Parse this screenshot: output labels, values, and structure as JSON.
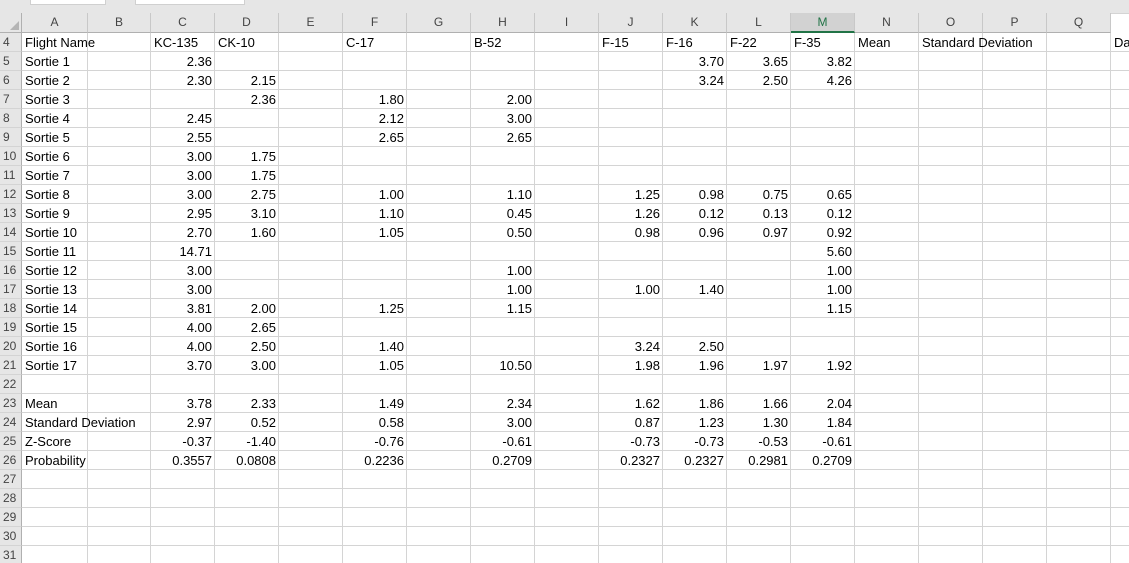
{
  "columns": [
    "A",
    "B",
    "C",
    "D",
    "E",
    "F",
    "G",
    "H",
    "I",
    "J",
    "K",
    "L",
    "M",
    "N",
    "O",
    "P",
    "Q"
  ],
  "selected_column": "M",
  "rows": [
    {
      "num": "4",
      "cells": [
        {
          "col": "A",
          "text": "Flight Name",
          "align": "l"
        },
        {
          "col": "C",
          "text": "KC-135",
          "align": "l"
        },
        {
          "col": "D",
          "text": "CK-10",
          "align": "l"
        },
        {
          "col": "F",
          "text": "C-17",
          "align": "l"
        },
        {
          "col": "H",
          "text": "B-52",
          "align": "l"
        },
        {
          "col": "J",
          "text": "F-15",
          "align": "l"
        },
        {
          "col": "K",
          "text": "F-16",
          "align": "l"
        },
        {
          "col": "L",
          "text": "F-22",
          "align": "l"
        },
        {
          "col": "M",
          "text": "F-35",
          "align": "l"
        },
        {
          "col": "N",
          "text": "Mean",
          "align": "l"
        },
        {
          "col": "O",
          "text": "Standard Deviation",
          "align": "l"
        },
        {
          "col": "R",
          "text": "Da",
          "align": "l"
        }
      ]
    },
    {
      "num": "5",
      "cells": [
        {
          "col": "A",
          "text": "Sortie 1",
          "align": "l"
        },
        {
          "col": "C",
          "text": "2.36",
          "align": "r"
        },
        {
          "col": "K",
          "text": "3.70",
          "align": "r"
        },
        {
          "col": "L",
          "text": "3.65",
          "align": "r"
        },
        {
          "col": "M",
          "text": "3.82",
          "align": "r"
        }
      ]
    },
    {
      "num": "6",
      "cells": [
        {
          "col": "A",
          "text": "Sortie 2",
          "align": "l"
        },
        {
          "col": "C",
          "text": "2.30",
          "align": "r"
        },
        {
          "col": "D",
          "text": "2.15",
          "align": "r"
        },
        {
          "col": "K",
          "text": "3.24",
          "align": "r"
        },
        {
          "col": "L",
          "text": "2.50",
          "align": "r"
        },
        {
          "col": "M",
          "text": "4.26",
          "align": "r"
        }
      ]
    },
    {
      "num": "7",
      "cells": [
        {
          "col": "A",
          "text": "Sortie 3",
          "align": "l"
        },
        {
          "col": "D",
          "text": "2.36",
          "align": "r"
        },
        {
          "col": "F",
          "text": "1.80",
          "align": "r"
        },
        {
          "col": "H",
          "text": "2.00",
          "align": "r"
        }
      ]
    },
    {
      "num": "8",
      "cells": [
        {
          "col": "A",
          "text": "Sortie 4",
          "align": "l"
        },
        {
          "col": "C",
          "text": "2.45",
          "align": "r"
        },
        {
          "col": "F",
          "text": "2.12",
          "align": "r"
        },
        {
          "col": "H",
          "text": "3.00",
          "align": "r"
        }
      ]
    },
    {
      "num": "9",
      "cells": [
        {
          "col": "A",
          "text": "Sortie 5",
          "align": "l"
        },
        {
          "col": "C",
          "text": "2.55",
          "align": "r"
        },
        {
          "col": "F",
          "text": "2.65",
          "align": "r"
        },
        {
          "col": "H",
          "text": "2.65",
          "align": "r"
        }
      ]
    },
    {
      "num": "10",
      "cells": [
        {
          "col": "A",
          "text": "Sortie 6",
          "align": "l"
        },
        {
          "col": "C",
          "text": "3.00",
          "align": "r"
        },
        {
          "col": "D",
          "text": "1.75",
          "align": "r"
        }
      ]
    },
    {
      "num": "11",
      "cells": [
        {
          "col": "A",
          "text": "Sortie 7",
          "align": "l"
        },
        {
          "col": "C",
          "text": "3.00",
          "align": "r"
        },
        {
          "col": "D",
          "text": "1.75",
          "align": "r"
        }
      ]
    },
    {
      "num": "12",
      "cells": [
        {
          "col": "A",
          "text": "Sortie 8",
          "align": "l"
        },
        {
          "col": "C",
          "text": "3.00",
          "align": "r"
        },
        {
          "col": "D",
          "text": "2.75",
          "align": "r"
        },
        {
          "col": "F",
          "text": "1.00",
          "align": "r"
        },
        {
          "col": "H",
          "text": "1.10",
          "align": "r"
        },
        {
          "col": "J",
          "text": "1.25",
          "align": "r"
        },
        {
          "col": "K",
          "text": "0.98",
          "align": "r"
        },
        {
          "col": "L",
          "text": "0.75",
          "align": "r"
        },
        {
          "col": "M",
          "text": "0.65",
          "align": "r"
        }
      ]
    },
    {
      "num": "13",
      "cells": [
        {
          "col": "A",
          "text": "Sortie 9",
          "align": "l"
        },
        {
          "col": "C",
          "text": "2.95",
          "align": "r"
        },
        {
          "col": "D",
          "text": "3.10",
          "align": "r"
        },
        {
          "col": "F",
          "text": "1.10",
          "align": "r"
        },
        {
          "col": "H",
          "text": "0.45",
          "align": "r"
        },
        {
          "col": "J",
          "text": "1.26",
          "align": "r"
        },
        {
          "col": "K",
          "text": "0.12",
          "align": "r"
        },
        {
          "col": "L",
          "text": "0.13",
          "align": "r"
        },
        {
          "col": "M",
          "text": "0.12",
          "align": "r"
        }
      ]
    },
    {
      "num": "14",
      "cells": [
        {
          "col": "A",
          "text": "Sortie 10",
          "align": "l"
        },
        {
          "col": "C",
          "text": "2.70",
          "align": "r"
        },
        {
          "col": "D",
          "text": "1.60",
          "align": "r"
        },
        {
          "col": "F",
          "text": "1.05",
          "align": "r"
        },
        {
          "col": "H",
          "text": "0.50",
          "align": "r"
        },
        {
          "col": "J",
          "text": "0.98",
          "align": "r"
        },
        {
          "col": "K",
          "text": "0.96",
          "align": "r"
        },
        {
          "col": "L",
          "text": "0.97",
          "align": "r"
        },
        {
          "col": "M",
          "text": "0.92",
          "align": "r"
        }
      ]
    },
    {
      "num": "15",
      "cells": [
        {
          "col": "A",
          "text": "Sortie 11",
          "align": "l"
        },
        {
          "col": "C",
          "text": "14.71",
          "align": "r"
        },
        {
          "col": "M",
          "text": "5.60",
          "align": "r"
        }
      ]
    },
    {
      "num": "16",
      "cells": [
        {
          "col": "A",
          "text": "Sortie 12",
          "align": "l"
        },
        {
          "col": "C",
          "text": "3.00",
          "align": "r"
        },
        {
          "col": "H",
          "text": "1.00",
          "align": "r"
        },
        {
          "col": "M",
          "text": "1.00",
          "align": "r"
        }
      ]
    },
    {
      "num": "17",
      "cells": [
        {
          "col": "A",
          "text": "Sortie 13",
          "align": "l"
        },
        {
          "col": "C",
          "text": "3.00",
          "align": "r"
        },
        {
          "col": "H",
          "text": "1.00",
          "align": "r"
        },
        {
          "col": "J",
          "text": "1.00",
          "align": "r"
        },
        {
          "col": "K",
          "text": "1.40",
          "align": "r"
        },
        {
          "col": "M",
          "text": "1.00",
          "align": "r"
        }
      ]
    },
    {
      "num": "18",
      "cells": [
        {
          "col": "A",
          "text": "Sortie 14",
          "align": "l"
        },
        {
          "col": "C",
          "text": "3.81",
          "align": "r"
        },
        {
          "col": "D",
          "text": "2.00",
          "align": "r"
        },
        {
          "col": "F",
          "text": "1.25",
          "align": "r"
        },
        {
          "col": "H",
          "text": "1.15",
          "align": "r"
        },
        {
          "col": "M",
          "text": "1.15",
          "align": "r"
        }
      ]
    },
    {
      "num": "19",
      "cells": [
        {
          "col": "A",
          "text": "Sortie 15",
          "align": "l"
        },
        {
          "col": "C",
          "text": "4.00",
          "align": "r"
        },
        {
          "col": "D",
          "text": "2.65",
          "align": "r"
        }
      ]
    },
    {
      "num": "20",
      "cells": [
        {
          "col": "A",
          "text": "Sortie 16",
          "align": "l"
        },
        {
          "col": "C",
          "text": "4.00",
          "align": "r"
        },
        {
          "col": "D",
          "text": "2.50",
          "align": "r"
        },
        {
          "col": "F",
          "text": "1.40",
          "align": "r"
        },
        {
          "col": "J",
          "text": "3.24",
          "align": "r"
        },
        {
          "col": "K",
          "text": "2.50",
          "align": "r"
        }
      ]
    },
    {
      "num": "21",
      "cells": [
        {
          "col": "A",
          "text": "Sortie 17",
          "align": "l"
        },
        {
          "col": "C",
          "text": "3.70",
          "align": "r"
        },
        {
          "col": "D",
          "text": "3.00",
          "align": "r"
        },
        {
          "col": "F",
          "text": "1.05",
          "align": "r"
        },
        {
          "col": "H",
          "text": "10.50",
          "align": "r"
        },
        {
          "col": "J",
          "text": "1.98",
          "align": "r"
        },
        {
          "col": "K",
          "text": "1.96",
          "align": "r"
        },
        {
          "col": "L",
          "text": "1.97",
          "align": "r"
        },
        {
          "col": "M",
          "text": "1.92",
          "align": "r"
        }
      ]
    },
    {
      "num": "22",
      "cells": []
    },
    {
      "num": "23",
      "cells": [
        {
          "col": "A",
          "text": "Mean",
          "align": "l"
        },
        {
          "col": "C",
          "text": "3.78",
          "align": "r"
        },
        {
          "col": "D",
          "text": "2.33",
          "align": "r"
        },
        {
          "col": "F",
          "text": "1.49",
          "align": "r"
        },
        {
          "col": "H",
          "text": "2.34",
          "align": "r"
        },
        {
          "col": "J",
          "text": "1.62",
          "align": "r"
        },
        {
          "col": "K",
          "text": "1.86",
          "align": "r"
        },
        {
          "col": "L",
          "text": "1.66",
          "align": "r"
        },
        {
          "col": "M",
          "text": "2.04",
          "align": "r"
        }
      ]
    },
    {
      "num": "24",
      "cells": [
        {
          "col": "A",
          "text": "Standard Deviation",
          "align": "l"
        },
        {
          "col": "C",
          "text": "2.97",
          "align": "r"
        },
        {
          "col": "D",
          "text": "0.52",
          "align": "r"
        },
        {
          "col": "F",
          "text": "0.58",
          "align": "r"
        },
        {
          "col": "H",
          "text": "3.00",
          "align": "r"
        },
        {
          "col": "J",
          "text": "0.87",
          "align": "r"
        },
        {
          "col": "K",
          "text": "1.23",
          "align": "r"
        },
        {
          "col": "L",
          "text": "1.30",
          "align": "r"
        },
        {
          "col": "M",
          "text": "1.84",
          "align": "r"
        }
      ]
    },
    {
      "num": "25",
      "cells": [
        {
          "col": "A",
          "text": "Z-Score",
          "align": "l"
        },
        {
          "col": "C",
          "text": "-0.37",
          "align": "r"
        },
        {
          "col": "D",
          "text": "-1.40",
          "align": "r"
        },
        {
          "col": "F",
          "text": "-0.76",
          "align": "r"
        },
        {
          "col": "H",
          "text": "-0.61",
          "align": "r"
        },
        {
          "col": "J",
          "text": "-0.73",
          "align": "r"
        },
        {
          "col": "K",
          "text": "-0.73",
          "align": "r"
        },
        {
          "col": "L",
          "text": "-0.53",
          "align": "r"
        },
        {
          "col": "M",
          "text": "-0.61",
          "align": "r"
        }
      ]
    },
    {
      "num": "26",
      "cells": [
        {
          "col": "A",
          "text": "Probability",
          "align": "l"
        },
        {
          "col": "C",
          "text": "0.3557",
          "align": "r"
        },
        {
          "col": "D",
          "text": "0.0808",
          "align": "r"
        },
        {
          "col": "F",
          "text": "0.2236",
          "align": "r"
        },
        {
          "col": "H",
          "text": "0.2709",
          "align": "r"
        },
        {
          "col": "J",
          "text": "0.2327",
          "align": "r"
        },
        {
          "col": "K",
          "text": "0.2327",
          "align": "r"
        },
        {
          "col": "L",
          "text": "0.2981",
          "align": "r"
        },
        {
          "col": "M",
          "text": "0.2709",
          "align": "r"
        }
      ]
    },
    {
      "num": "27",
      "cells": []
    },
    {
      "num": "28",
      "cells": []
    },
    {
      "num": "29",
      "cells": []
    },
    {
      "num": "30",
      "cells": []
    },
    {
      "num": "31",
      "cells": []
    }
  ]
}
